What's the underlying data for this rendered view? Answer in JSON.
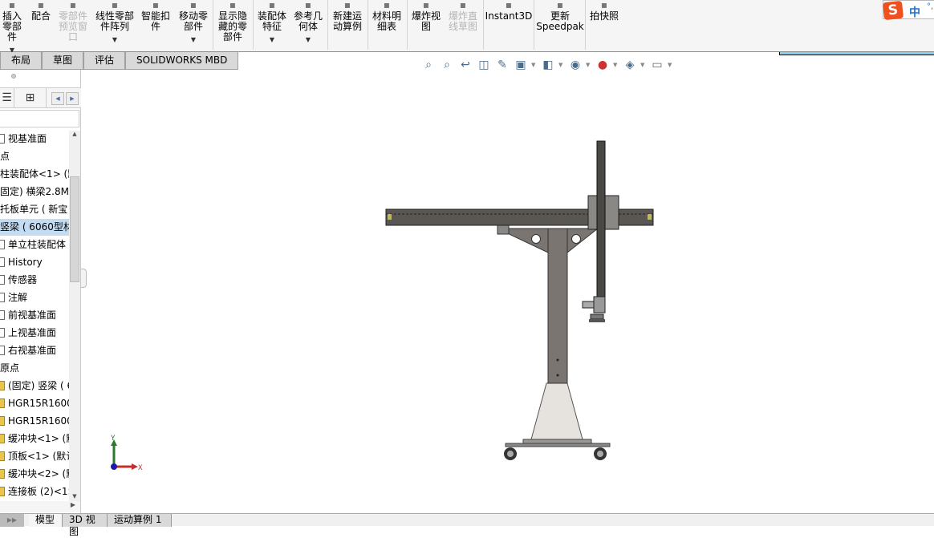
{
  "toolbar": {
    "buttons": [
      {
        "label": "插入零部件",
        "icon": "insert-component-icon",
        "disabled": false,
        "dropdown": true
      },
      {
        "label": "配合",
        "icon": "mate-paperclip-icon",
        "disabled": false,
        "dropdown": false
      },
      {
        "label": "零部件预览窗口",
        "icon": "component-preview-icon",
        "disabled": true,
        "dropdown": false
      },
      {
        "label": "线性零部件阵列",
        "icon": "linear-pattern-icon",
        "disabled": false,
        "dropdown": true
      },
      {
        "label": "智能扣件",
        "icon": "smart-fastener-icon",
        "disabled": false,
        "dropdown": false
      },
      {
        "label": "移动零部件",
        "icon": "move-component-icon",
        "disabled": false,
        "dropdown": true
      },
      {
        "label": "显示隐藏的零部件",
        "icon": "show-hidden-icon",
        "disabled": false,
        "dropdown": false
      },
      {
        "label": "装配体特征",
        "icon": "assembly-feature-icon",
        "disabled": false,
        "dropdown": true
      },
      {
        "label": "参考几何体",
        "icon": "reference-geometry-icon",
        "disabled": false,
        "dropdown": true
      },
      {
        "label": "新建运动算例",
        "icon": "motion-study-icon",
        "disabled": false,
        "dropdown": false
      },
      {
        "label": "材料明细表",
        "icon": "bom-icon",
        "disabled": false,
        "dropdown": false
      },
      {
        "label": "爆炸视图",
        "icon": "exploded-view-icon",
        "disabled": false,
        "dropdown": false
      },
      {
        "label": "爆炸直线草图",
        "icon": "explode-line-sketch-icon",
        "disabled": true,
        "dropdown": false
      },
      {
        "label": "Instant3D",
        "icon": "instant3d-icon",
        "disabled": false,
        "dropdown": false
      },
      {
        "label": "更新Speedpak",
        "icon": "speedpak-icon",
        "disabled": false,
        "dropdown": false
      },
      {
        "label": "拍快照",
        "icon": "camera-icon",
        "disabled": false,
        "dropdown": false
      }
    ]
  },
  "ime": {
    "logo": "S",
    "mode": "中",
    "punct": "°,"
  },
  "tabs": [
    "布局",
    "草图",
    "评估",
    "SOLIDWORKS MBD"
  ],
  "tree": {
    "items": [
      {
        "label": "视基准面",
        "icon": "plane"
      },
      {
        "label": "点",
        "icon": "none"
      },
      {
        "label": "柱装配体<1> (默",
        "icon": "none"
      },
      {
        "label": "固定) 横梁2.8M (",
        "icon": "none"
      },
      {
        "label": "托板单元 ( 新宝",
        "icon": "none"
      },
      {
        "label": "竖梁 ( 6060型材",
        "icon": "none",
        "selected": true
      },
      {
        "label": "单立柱装配体",
        "icon": "plane"
      },
      {
        "label": "History",
        "icon": "plane"
      },
      {
        "label": "传感器",
        "icon": "plane"
      },
      {
        "label": "注解",
        "icon": "plane"
      },
      {
        "label": "前视基准面",
        "icon": "plane"
      },
      {
        "label": "上视基准面",
        "icon": "plane"
      },
      {
        "label": "右视基准面",
        "icon": "plane"
      },
      {
        "label": "原点",
        "icon": "none"
      },
      {
        "label": "(固定) 竖梁 ( 6",
        "icon": "part"
      },
      {
        "label": "HGR15R1600",
        "icon": "part"
      },
      {
        "label": "HGR15R1600",
        "icon": "part"
      },
      {
        "label": "缓冲块<1> (默",
        "icon": "part"
      },
      {
        "label": "顶板<1> (默认",
        "icon": "part"
      },
      {
        "label": "缓冲块<2> (默",
        "icon": "part"
      },
      {
        "label": "连接板 (2)<1>",
        "icon": "part"
      }
    ]
  },
  "view_toolbar": [
    "zoom-to-fit-icon",
    "zoom-to-area-icon",
    "previous-view-icon",
    "section-view-icon",
    "dynamic-annotation-icon",
    "view-orientation-icon",
    "display-style-icon",
    "hide-show-icon",
    "edit-appearance-icon",
    "apply-scene-icon",
    "view-settings-icon"
  ],
  "triad": {
    "x": "X",
    "y": "Y"
  },
  "bottom_tabs": [
    "模型",
    "3D 视图",
    "运动算例 1"
  ]
}
